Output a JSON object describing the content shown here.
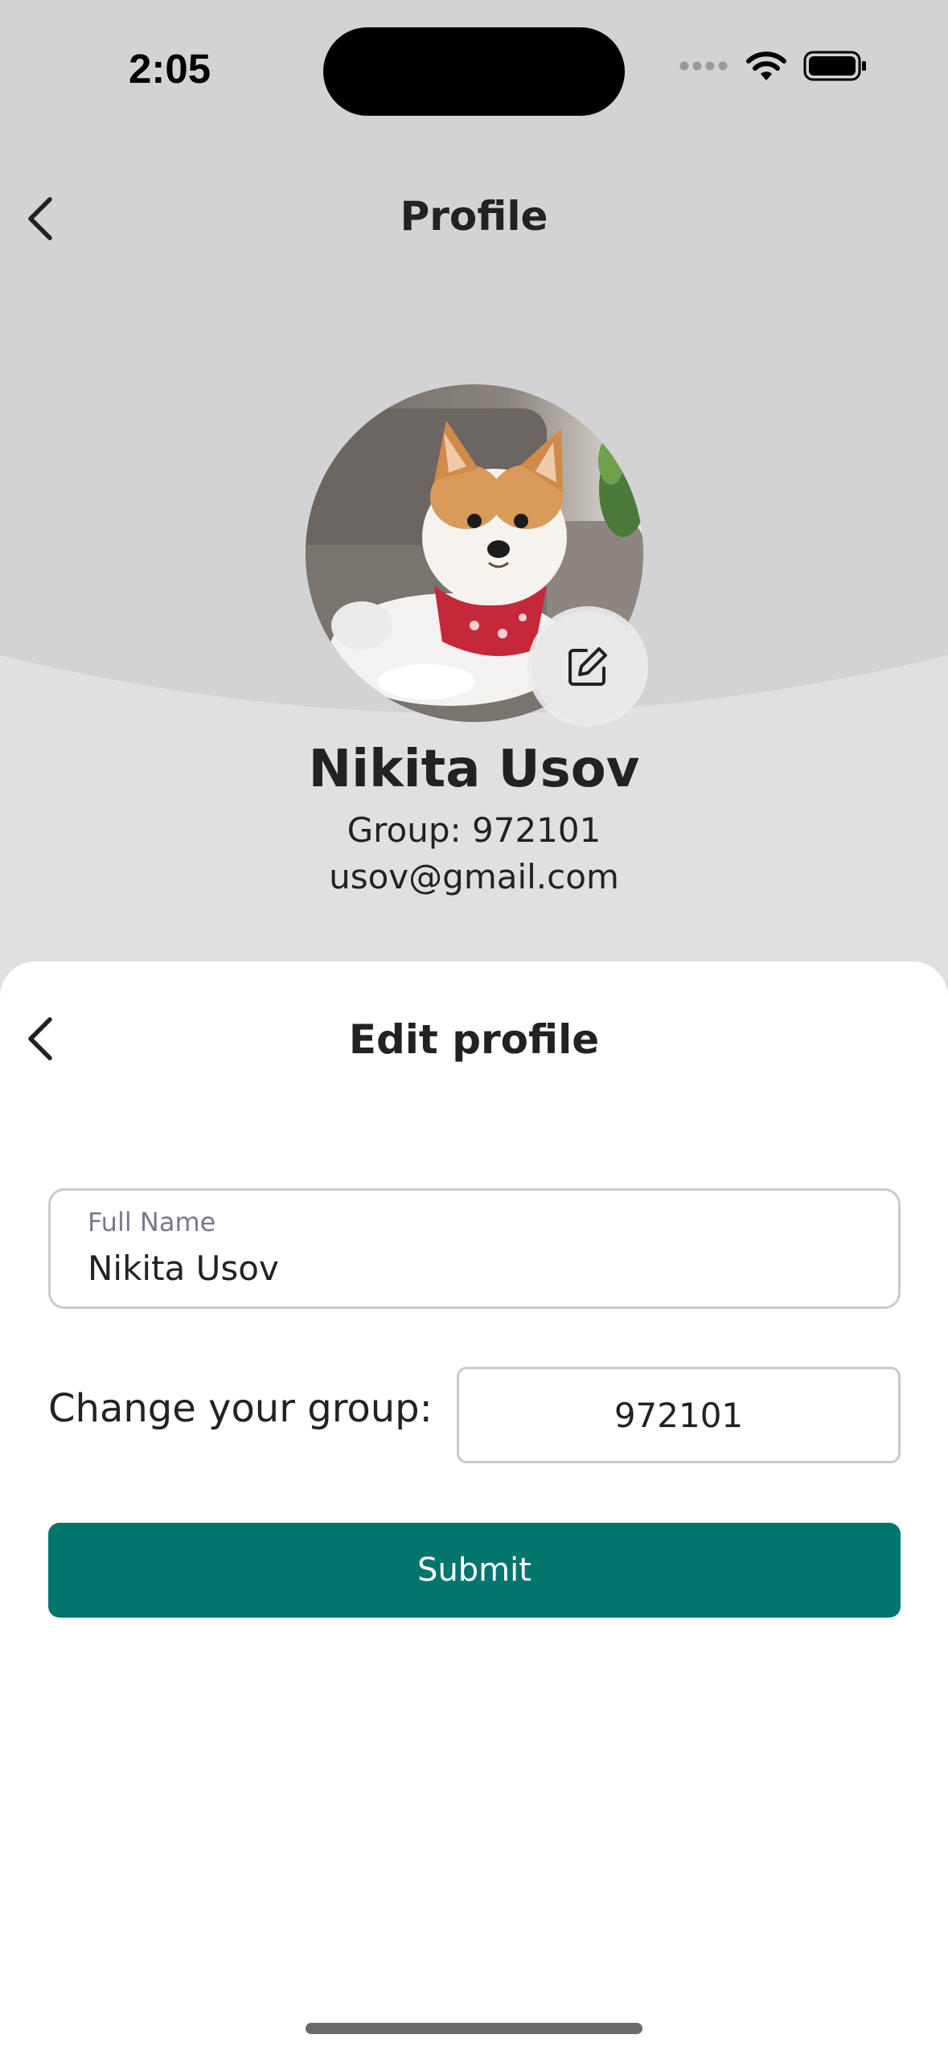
{
  "status_bar": {
    "time": "2:05"
  },
  "header": {
    "title": "Profile",
    "back_icon": "chevron-left-icon"
  },
  "profile": {
    "name": "Nikita Usov",
    "group": "Group: 972101",
    "email": "usov@gmail.com",
    "avatar_alt": "dog photo",
    "edit_icon": "edit-icon"
  },
  "edit_sheet": {
    "title": "Edit profile",
    "back_icon": "chevron-left-icon",
    "full_name": {
      "label": "Full Name",
      "value": "Nikita Usov"
    },
    "group": {
      "label": "Change your group:",
      "value": "972101"
    },
    "submit_label": "Submit"
  },
  "colors": {
    "accent": "#02756d",
    "background_top": "#e0e0e1",
    "background_arc": "#d3d3d5",
    "text": "#222222"
  }
}
